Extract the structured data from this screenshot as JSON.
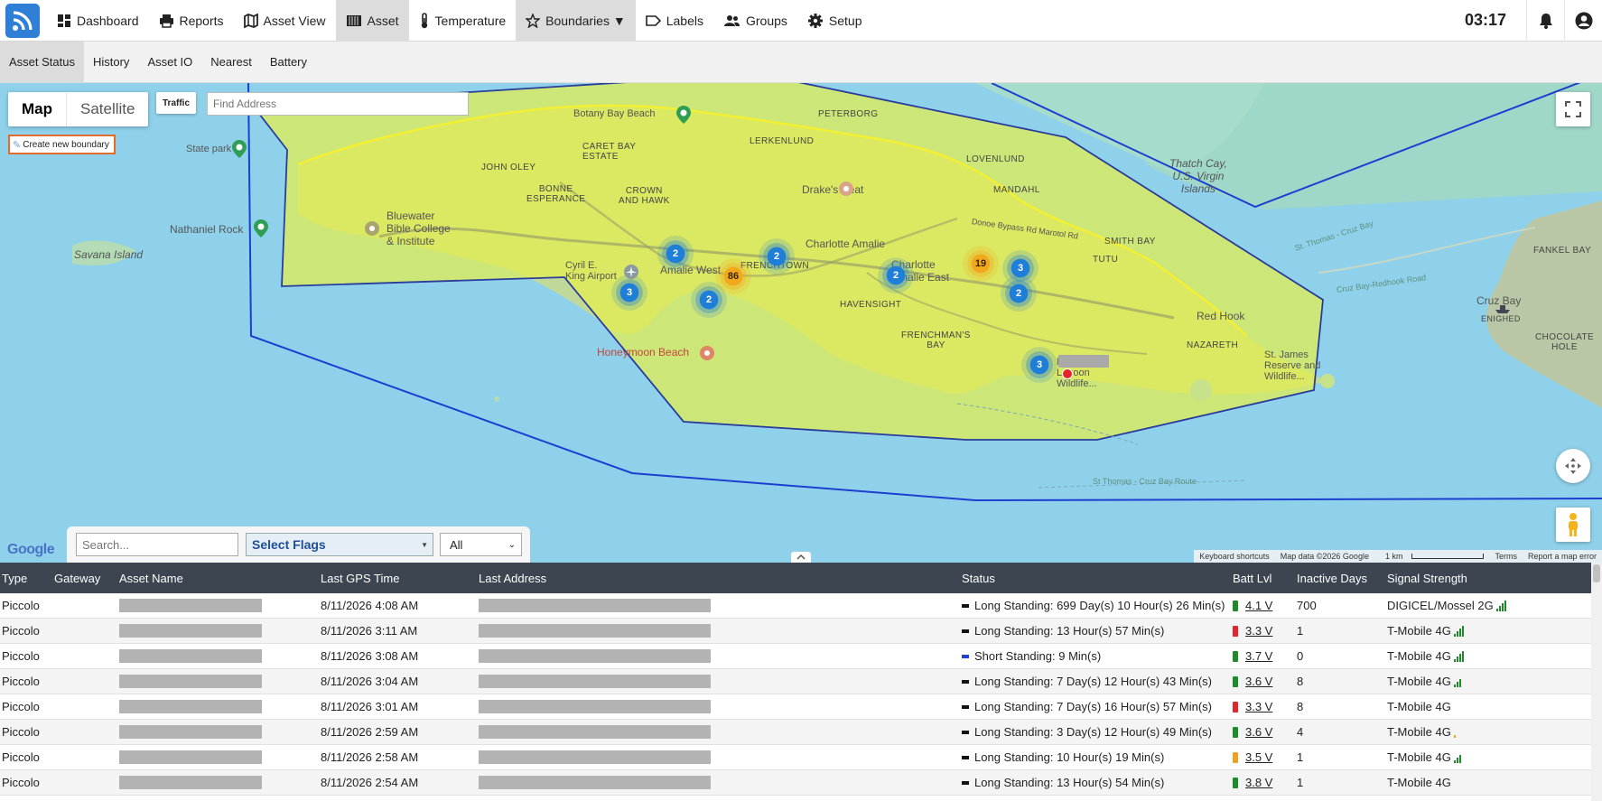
{
  "header": {
    "nav": [
      {
        "label": "Dashboard",
        "icon": "dashboard-icon"
      },
      {
        "label": "Reports",
        "icon": "printer-icon"
      },
      {
        "label": "Asset View",
        "icon": "map-icon"
      },
      {
        "label": "Asset",
        "icon": "container-icon"
      },
      {
        "label": "Temperature",
        "icon": "thermometer-icon"
      },
      {
        "label": "Boundaries ▼",
        "icon": "star-icon"
      },
      {
        "label": "Labels",
        "icon": "tag-icon"
      },
      {
        "label": "Groups",
        "icon": "users-icon"
      },
      {
        "label": "Setup",
        "icon": "gear-icon"
      }
    ],
    "clock": "03:17"
  },
  "subnav": [
    "Asset Status",
    "History",
    "Asset IO",
    "Nearest",
    "Battery"
  ],
  "map": {
    "type_map": "Map",
    "type_satellite": "Satellite",
    "traffic": "Traffic",
    "find_address_placeholder": "Find Address",
    "create_boundary": "Create new boundary",
    "google": "Google",
    "attrib": {
      "shortcuts": "Keyboard shortcuts",
      "data": "Map data ©2026 Google",
      "scale": "1 km",
      "terms": "Terms",
      "report": "Report a map error"
    },
    "labels": {
      "boatbeach": "Botany Bay Beach",
      "statepark": "State park",
      "nathaniel": "Nathaniel Rock",
      "savana": "Savana Island",
      "peterborg": "PETERBORG",
      "carebay": "CARET BAY\nESTATE",
      "johnoley": "JOHN OLEY",
      "lerkenlund": "LERKENLUND",
      "lovenlund": "LOVENLUND",
      "bonne": "BONNE\nESPERANCE",
      "crown": "CROWN\nAND HAWK",
      "drakes": "Drake's Seat",
      "mandahl": "MANDAHL",
      "thatch": "Thatch Cay,\nU.S. Virgin\nIslands",
      "bluewater": "Bluewater\nBible College\n& Institute",
      "charlotte": "Charlotte\nAmalie",
      "amaliewest": "Amalie West",
      "frenchtown": "FRENCHTOWN",
      "ceast": "Charlotte\nAmalie East",
      "tutu": "TUTU",
      "smithbay": "SMITH BAY",
      "airport": "Cyril E.\nKing Airport",
      "havensight": "HAVENSIGHT",
      "frenchmans": "FRENCHMAN'S\nBAY",
      "redhook": "Red Hook",
      "nazareth": "NAZARETH",
      "honeymoon": "Honeymoon Beach",
      "mangrove": "Mangrove\nLagoon\nWildlife...",
      "stjames": "St. James\nReserve and\nWildlife...",
      "cruzbay": "Cruz Bay",
      "enighed": "ENIGHED",
      "chocolate": "CHOCOLATE\nHOLE",
      "fankel": "FANKEL BAY",
      "donoe": "Donoe Bypass Rd Marotol Rd",
      "cruzroad": "Cruz Bay-Redhook Road",
      "stthomasroad": "St. Thomas - Cruz Bay",
      "stthomasroad2": "St Thomas - Cruz Bay Route"
    },
    "clusters": [
      {
        "count": "2",
        "color": "blue"
      },
      {
        "count": "86",
        "color": "orange"
      },
      {
        "count": "2",
        "color": "blue"
      },
      {
        "count": "3",
        "color": "blue"
      },
      {
        "count": "2",
        "color": "blue"
      },
      {
        "count": "2",
        "color": "blue"
      },
      {
        "count": "19",
        "color": "orange"
      },
      {
        "count": "3",
        "color": "blue"
      },
      {
        "count": "2",
        "color": "blue"
      },
      {
        "count": "3",
        "color": "blue"
      }
    ]
  },
  "filters": {
    "search_placeholder": "Search...",
    "flags": "Select Flags",
    "all": "All"
  },
  "table": {
    "headers": [
      "Type",
      "Gateway",
      "Asset Name",
      "Last GPS Time",
      "Last Address",
      "Status",
      "Batt Lvl",
      "Inactive Days",
      "Signal Strength"
    ],
    "rows": [
      {
        "type": "Piccolo",
        "gps": "8/11/2026 4:08 AM",
        "status": "Long Standing: 699 Day(s) 10 Hour(s) 26 Min(s)",
        "status_color": "#111111",
        "batt": "4.1 V",
        "batt_color": "#1f8a2a",
        "inactive": "700",
        "signal": "DIGICEL/Mossel 2G",
        "bars": 4,
        "bar_color": "#1f8a2a"
      },
      {
        "type": "Piccolo",
        "gps": "8/11/2026 3:11 AM",
        "status": "Long Standing: 13 Hour(s) 57 Min(s)",
        "status_color": "#111111",
        "batt": "3.3 V",
        "batt_color": "#e0262b",
        "inactive": "1",
        "signal": "T-Mobile 4G",
        "bars": 4,
        "bar_color": "#1f8a2a"
      },
      {
        "type": "Piccolo",
        "gps": "8/11/2026 3:08 AM",
        "status": "Short Standing: 9 Min(s)",
        "status_color": "#1f3fd6",
        "batt": "3.7 V",
        "batt_color": "#1f8a2a",
        "inactive": "0",
        "signal": "T-Mobile 4G",
        "bars": 4,
        "bar_color": "#1f8a2a"
      },
      {
        "type": "Piccolo",
        "gps": "8/11/2026 3:04 AM",
        "status": "Long Standing: 7 Day(s) 12 Hour(s) 43 Min(s)",
        "status_color": "#111111",
        "batt": "3.6 V",
        "batt_color": "#1f8a2a",
        "inactive": "8",
        "signal": "T-Mobile 4G",
        "bars": 3,
        "bar_color": "#1f8a2a"
      },
      {
        "type": "Piccolo",
        "gps": "8/11/2026 3:01 AM",
        "status": "Long Standing: 7 Day(s) 16 Hour(s) 57 Min(s)",
        "status_color": "#111111",
        "batt": "3.3 V",
        "batt_color": "#e0262b",
        "inactive": "8",
        "signal": "T-Mobile 4G",
        "bars": 0,
        "bar_color": "#1f8a2a"
      },
      {
        "type": "Piccolo",
        "gps": "8/11/2026 2:59 AM",
        "status": "Long Standing: 3 Day(s) 12 Hour(s) 49 Min(s)",
        "status_color": "#111111",
        "batt": "3.6 V",
        "batt_color": "#1f8a2a",
        "inactive": "4",
        "signal": "T-Mobile 4G",
        "bars": 1,
        "bar_color": "#f0a020"
      },
      {
        "type": "Piccolo",
        "gps": "8/11/2026 2:58 AM",
        "status": "Long Standing: 10 Hour(s) 19 Min(s)",
        "status_color": "#111111",
        "batt": "3.5 V",
        "batt_color": "#f0a020",
        "inactive": "1",
        "signal": "T-Mobile 4G",
        "bars": 3,
        "bar_color": "#1f8a2a"
      },
      {
        "type": "Piccolo",
        "gps": "8/11/2026 2:54 AM",
        "status": "Long Standing: 13 Hour(s) 54 Min(s)",
        "status_color": "#111111",
        "batt": "3.8 V",
        "batt_color": "#1f8a2a",
        "inactive": "1",
        "signal": "T-Mobile 4G",
        "bars": 0,
        "bar_color": "#1f8a2a"
      }
    ]
  }
}
